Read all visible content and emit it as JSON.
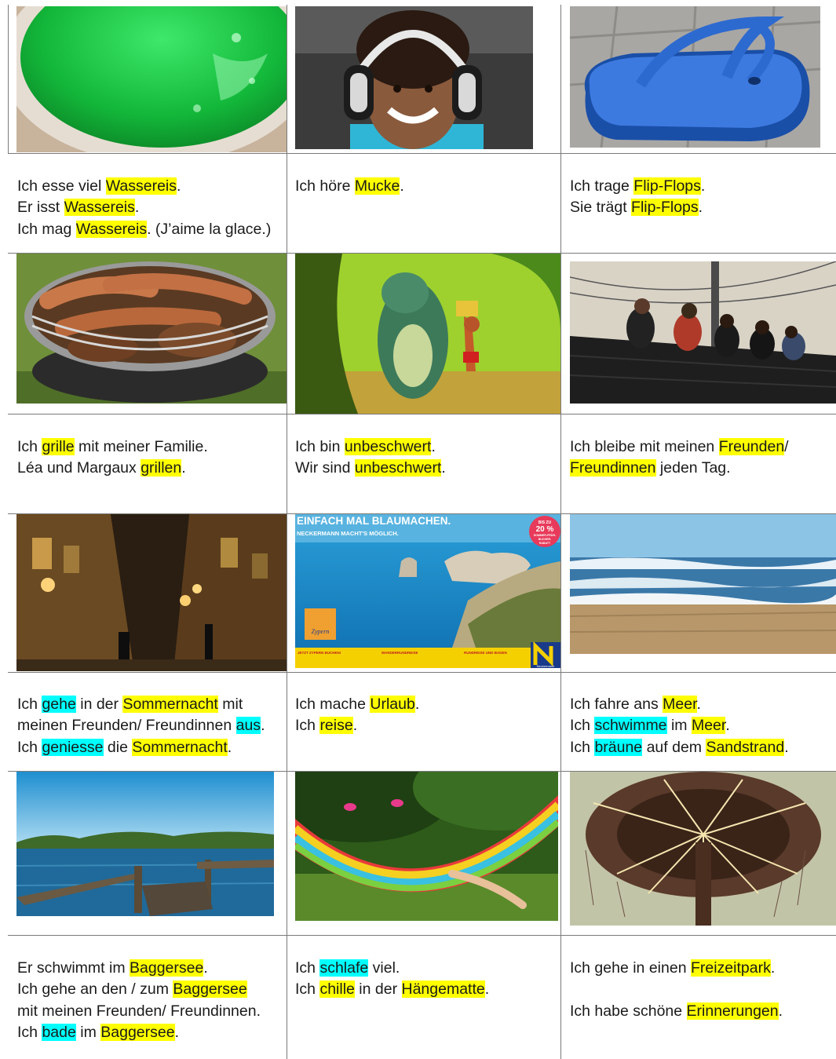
{
  "images": [
    {
      "name": "photo-wassereis",
      "subject": "green water ice in a cup"
    },
    {
      "name": "photo-child-headphones",
      "subject": "smiling child wearing headphones"
    },
    {
      "name": "photo-flip-flop",
      "subject": "blue flip-flop on paving stones"
    },
    {
      "name": "photo-grill",
      "subject": "sausages and meat on a small charcoal grill"
    },
    {
      "name": "photo-jungle-book",
      "subject": "cartoon bear and boy with bananas"
    },
    {
      "name": "photo-friends-roof",
      "subject": "friends sitting on a roof"
    },
    {
      "name": "photo-night-street",
      "subject": "old town street at night"
    },
    {
      "name": "photo-cyprus-ad",
      "subject": "travel advertisement with sea and rocks"
    },
    {
      "name": "photo-beach",
      "subject": "waves on a sandy beach"
    },
    {
      "name": "photo-lake",
      "subject": "lake with wooden jetty"
    },
    {
      "name": "photo-hammock",
      "subject": "person lying in a striped hammock"
    },
    {
      "name": "photo-carousel",
      "subject": "chain swing carousel from below"
    }
  ],
  "poster": {
    "headline": "EINFACH MAL BLAUMACHEN.",
    "subline": "NECKERMANN MACHT'S MÖGLICH.",
    "badge_line1": "BIS ZU",
    "badge_line2": "20 %",
    "badge_line3": "SOMMER-FRÜH-",
    "badge_line4": "BUCHER-",
    "badge_line5": "RABATT",
    "logo_text": "Zypern",
    "footer_col1": "JETZT ZYPERN BUCHEN!",
    "footer_col2": "WANDERRUNDREISE",
    "footer_col3": "RUNDREISE UND BADEN",
    "brand": "Neckermann"
  },
  "cells": [
    {
      "name": "text-cell-wassereis",
      "lines": [
        [
          {
            "t": "Ich esse viel "
          },
          {
            "t": "Wassereis",
            "hl": "y"
          },
          {
            "t": "."
          }
        ],
        [
          {
            "t": "Er isst "
          },
          {
            "t": "Wassereis",
            "hl": "y"
          },
          {
            "t": "."
          }
        ],
        [
          {
            "t": "Ich mag "
          },
          {
            "t": "Wassereis",
            "hl": "y"
          },
          {
            "t": ". (J’aime la glace.)"
          }
        ]
      ]
    },
    {
      "name": "text-cell-mucke",
      "lines": [
        [
          {
            "t": "Ich höre "
          },
          {
            "t": "Mucke",
            "hl": "y"
          },
          {
            "t": "."
          }
        ]
      ]
    },
    {
      "name": "text-cell-flip-flops",
      "lines": [
        [
          {
            "t": "Ich trage "
          },
          {
            "t": "Flip-Flops",
            "hl": "y"
          },
          {
            "t": "."
          }
        ],
        [
          {
            "t": "Sie trägt "
          },
          {
            "t": "Flip-Flops",
            "hl": "y"
          },
          {
            "t": "."
          }
        ]
      ]
    },
    {
      "name": "text-cell-grillen",
      "lines": [
        [
          {
            "t": "Ich "
          },
          {
            "t": "grille",
            "hl": "y"
          },
          {
            "t": " mit meiner Familie."
          }
        ],
        [
          {
            "t": "Léa und Margaux "
          },
          {
            "t": "grillen",
            "hl": "y"
          },
          {
            "t": "."
          }
        ]
      ]
    },
    {
      "name": "text-cell-unbeschwert",
      "lines": [
        [
          {
            "t": "Ich bin "
          },
          {
            "t": "unbeschwert",
            "hl": "y"
          },
          {
            "t": "."
          }
        ],
        [
          {
            "t": "Wir sind "
          },
          {
            "t": "unbeschwert",
            "hl": "y"
          },
          {
            "t": "."
          }
        ]
      ]
    },
    {
      "name": "text-cell-freunden",
      "lines": [
        [
          {
            "t": "Ich bleibe mit meinen "
          },
          {
            "t": "Freunden",
            "hl": "y"
          },
          {
            "t": "/"
          }
        ],
        [
          {
            "t": "Freundinnen",
            "hl": "y"
          },
          {
            "t": " jeden Tag."
          }
        ]
      ]
    },
    {
      "name": "text-cell-sommernacht",
      "lines": [
        [
          {
            "t": "Ich "
          },
          {
            "t": "gehe",
            "hl": "c"
          },
          {
            "t": " in der "
          },
          {
            "t": "Sommernacht",
            "hl": "y"
          },
          {
            "t": " mit"
          }
        ],
        [
          {
            "t": "meinen Freunden/ Freundinnen "
          },
          {
            "t": "aus",
            "hl": "c"
          },
          {
            "t": "."
          }
        ],
        [
          {
            "t": "Ich "
          },
          {
            "t": "geniesse",
            "hl": "c"
          },
          {
            "t": " die "
          },
          {
            "t": "Sommernacht",
            "hl": "y"
          },
          {
            "t": "."
          }
        ]
      ]
    },
    {
      "name": "text-cell-urlaub",
      "lines": [
        [
          {
            "t": "Ich mache "
          },
          {
            "t": "Urlaub",
            "hl": "y"
          },
          {
            "t": "."
          }
        ],
        [
          {
            "t": "Ich "
          },
          {
            "t": "reise",
            "hl": "y"
          },
          {
            "t": "."
          }
        ]
      ]
    },
    {
      "name": "text-cell-meer",
      "lines": [
        [
          {
            "t": "Ich fahre ans "
          },
          {
            "t": "Meer",
            "hl": "y"
          },
          {
            "t": "."
          }
        ],
        [
          {
            "t": "Ich "
          },
          {
            "t": "schwimme",
            "hl": "c"
          },
          {
            "t": " im "
          },
          {
            "t": "Meer",
            "hl": "y"
          },
          {
            "t": "."
          }
        ],
        [
          {
            "t": "Ich "
          },
          {
            "t": "bräune",
            "hl": "c"
          },
          {
            "t": " auf dem "
          },
          {
            "t": "Sandstrand",
            "hl": "y"
          },
          {
            "t": "."
          }
        ]
      ]
    },
    {
      "name": "text-cell-baggersee",
      "lines": [
        [
          {
            "t": "Er schwimmt im "
          },
          {
            "t": "Baggersee",
            "hl": "y"
          },
          {
            "t": "."
          }
        ],
        [
          {
            "t": "Ich gehe an den / zum "
          },
          {
            "t": "Baggersee",
            "hl": "y"
          }
        ],
        [
          {
            "t": "mit meinen Freunden/ Freundinnen."
          }
        ],
        [
          {
            "t": "Ich "
          },
          {
            "t": "bade",
            "hl": "c"
          },
          {
            "t": " im "
          },
          {
            "t": "Baggersee",
            "hl": "y"
          },
          {
            "t": "."
          }
        ]
      ]
    },
    {
      "name": "text-cell-haengematte",
      "lines": [
        [
          {
            "t": "Ich "
          },
          {
            "t": "schlafe",
            "hl": "c"
          },
          {
            "t": " viel."
          }
        ],
        [
          {
            "t": "Ich "
          },
          {
            "t": "chille",
            "hl": "y"
          },
          {
            "t": " in der "
          },
          {
            "t": "Hängematte",
            "hl": "y"
          },
          {
            "t": "."
          }
        ]
      ]
    },
    {
      "name": "text-cell-freizeitpark",
      "lines": [
        [
          {
            "t": "Ich gehe in einen "
          },
          {
            "t": "Freizeitpark",
            "hl": "y"
          },
          {
            "t": "."
          }
        ],
        [
          {
            "t": ""
          }
        ],
        [
          {
            "t": "Ich habe schöne "
          },
          {
            "t": "Erinnerungen",
            "hl": "y"
          },
          {
            "t": "."
          }
        ]
      ]
    }
  ],
  "colors": {
    "highlight_yellow": "#ffff00",
    "highlight_cyan": "#00ffff",
    "grid": "#7a7a7a"
  }
}
